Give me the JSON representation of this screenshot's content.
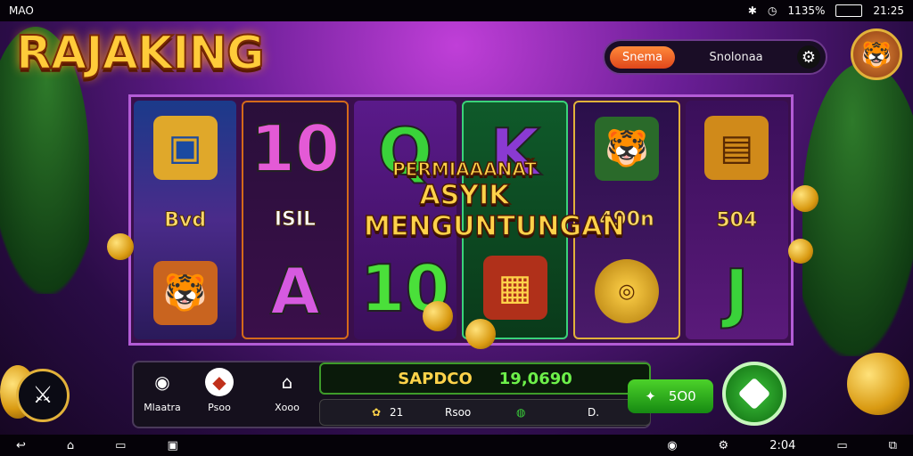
{
  "status_bar": {
    "left_text": "MAO",
    "battery_text": "1135%",
    "time_text": "21:25"
  },
  "logo": {
    "text": "RAJAKING"
  },
  "top_bar": {
    "orange_button": "Snema",
    "label": "Snolonaa",
    "settings_icon": "gear-icon"
  },
  "avatar": {
    "icon": "tiger-icon"
  },
  "reels": [
    {
      "top": "screen-chest-icon",
      "mid": "Bvd",
      "bottom": "tiger-icon"
    },
    {
      "top": "10",
      "mid": "ISIL",
      "bottom": "A"
    },
    {
      "top": "Q",
      "mid": "",
      "bottom": "10"
    },
    {
      "top": "K",
      "mid": "",
      "bottom": "treasure-box-icon"
    },
    {
      "top": "tiger-icon",
      "mid": "490n",
      "bottom": "gold-coin-icon"
    },
    {
      "top": "golden-chest-icon",
      "mid": "504",
      "bottom": "J"
    }
  ],
  "banner": {
    "line1": "PERMIAAANAŤ",
    "line2": "ASYIK",
    "line3": "MENGUNTUNGAN"
  },
  "bottom_buttons": [
    {
      "icon": "camera-icon",
      "label": "Mlaatra"
    },
    {
      "icon": "shield-icon",
      "label": "Psoo"
    },
    {
      "icon": "house-icon",
      "label": "Xooo"
    }
  ],
  "balance": {
    "label": "SAPDCO",
    "value": "19,0690"
  },
  "subrow": {
    "item1": "21",
    "item2": "Rsoo",
    "item3": "D."
  },
  "auto_button": {
    "icon": "star-icon",
    "value": "5O0"
  },
  "spin_button": {
    "icon": "diamond-icon"
  },
  "nav_bar": {
    "time_text": "2:04"
  },
  "colors": {
    "background": "#6a1e96",
    "logo_gold": "#ffcc3a",
    "reel_frame": "#b35cd6",
    "win_green": "#6df04a",
    "spin_green": "#3cc23a",
    "orange": "#ff8a3a"
  }
}
